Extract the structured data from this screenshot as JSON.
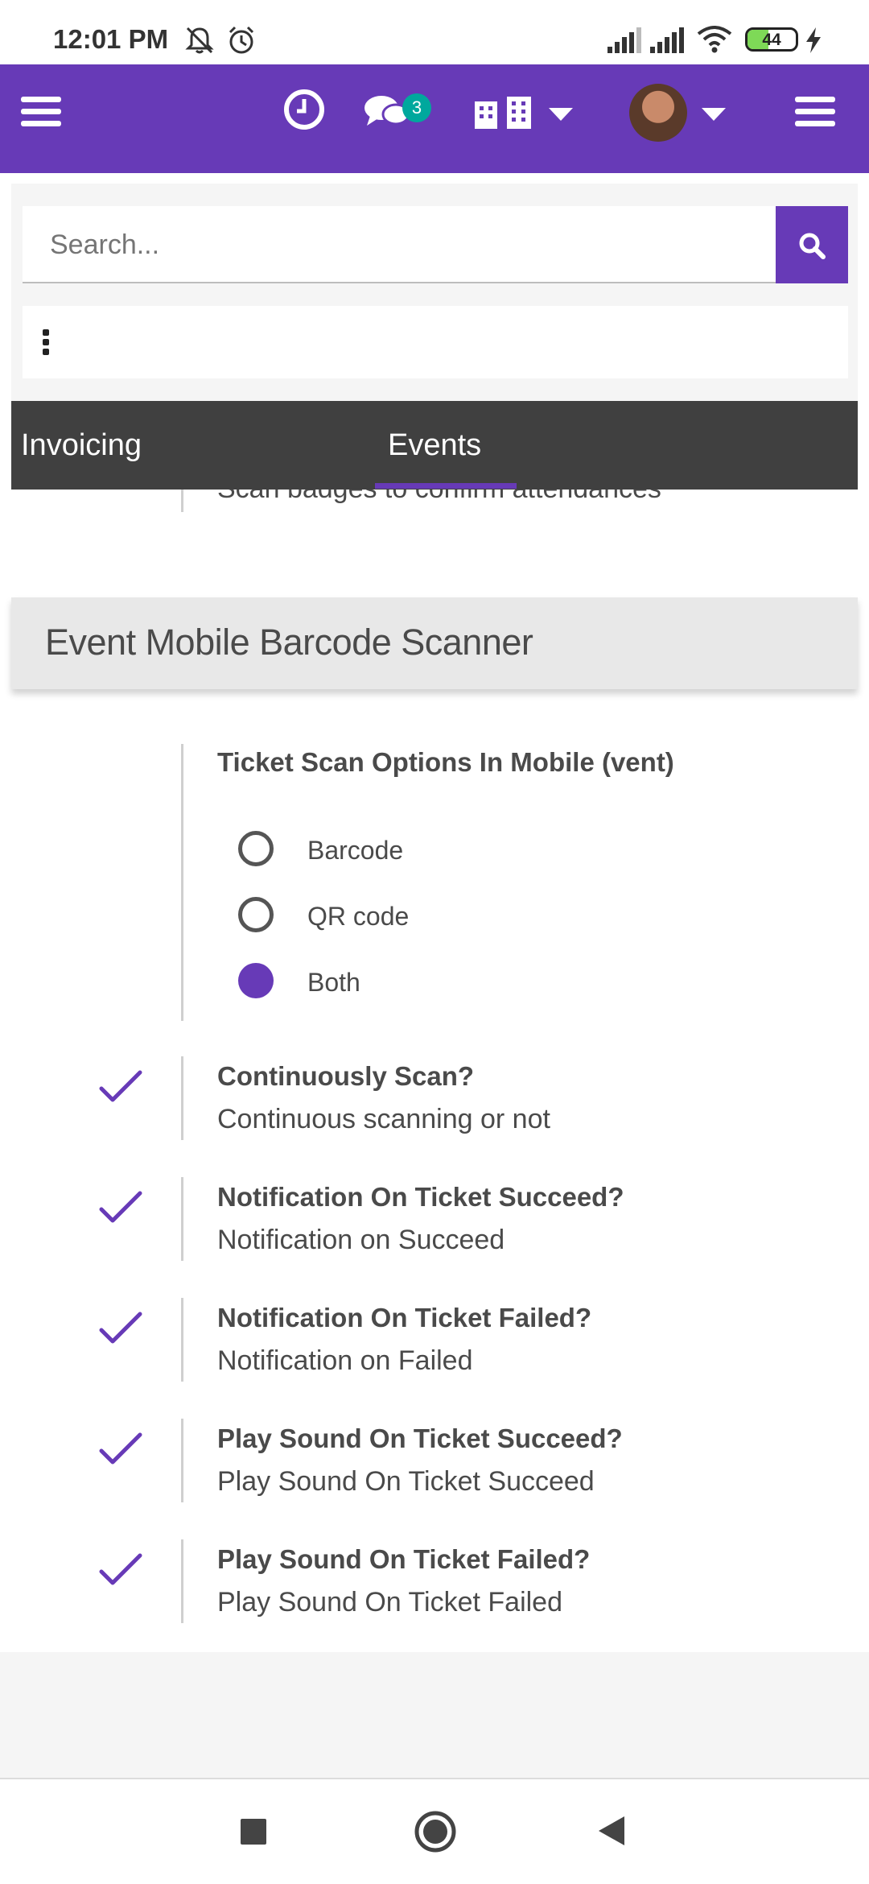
{
  "status_bar": {
    "time": "12:01 PM",
    "battery": "44",
    "battery_level": 0.44,
    "icons": [
      "mute-icon",
      "alarm-icon",
      "signal-icon",
      "signal-icon",
      "wifi-icon",
      "battery-icon",
      "charging-icon"
    ]
  },
  "appbar": {
    "color": "#673ab7",
    "messages_badge": "3",
    "icons": [
      "menu-icon",
      "clock-icon",
      "chat-icon",
      "building-icon",
      "avatar",
      "menu-icon"
    ]
  },
  "search": {
    "placeholder": "Search...",
    "button_icon": "search-icon"
  },
  "tabs": [
    {
      "label": "Invoicing",
      "active": false
    },
    {
      "label": "Events",
      "active": true
    }
  ],
  "content": {
    "partial_text": "Scan badges to confirm attendances",
    "section_title": "Event Mobile Barcode Scanner",
    "scan_options": {
      "title": "Ticket Scan Options In Mobile (vent)",
      "options": [
        {
          "label": "Barcode",
          "checked": false
        },
        {
          "label": "QR code",
          "checked": false
        },
        {
          "label": "Both",
          "checked": true
        }
      ]
    },
    "settings": [
      {
        "title": "Continuously Scan?",
        "desc": "Continuous scanning or not",
        "checked": true
      },
      {
        "title": "Notification On Ticket Succeed?",
        "desc": "Notification on Succeed",
        "checked": true
      },
      {
        "title": "Notification On Ticket Failed?",
        "desc": "Notification on Failed",
        "checked": true
      },
      {
        "title": "Play Sound On Ticket Succeed?",
        "desc": "Play Sound On Ticket Succeed",
        "checked": true
      },
      {
        "title": "Play Sound On Ticket Failed?",
        "desc": "Play Sound On Ticket Failed",
        "checked": true
      }
    ]
  },
  "navbar": {
    "icons": [
      "recents-icon",
      "home-icon",
      "back-icon"
    ]
  }
}
